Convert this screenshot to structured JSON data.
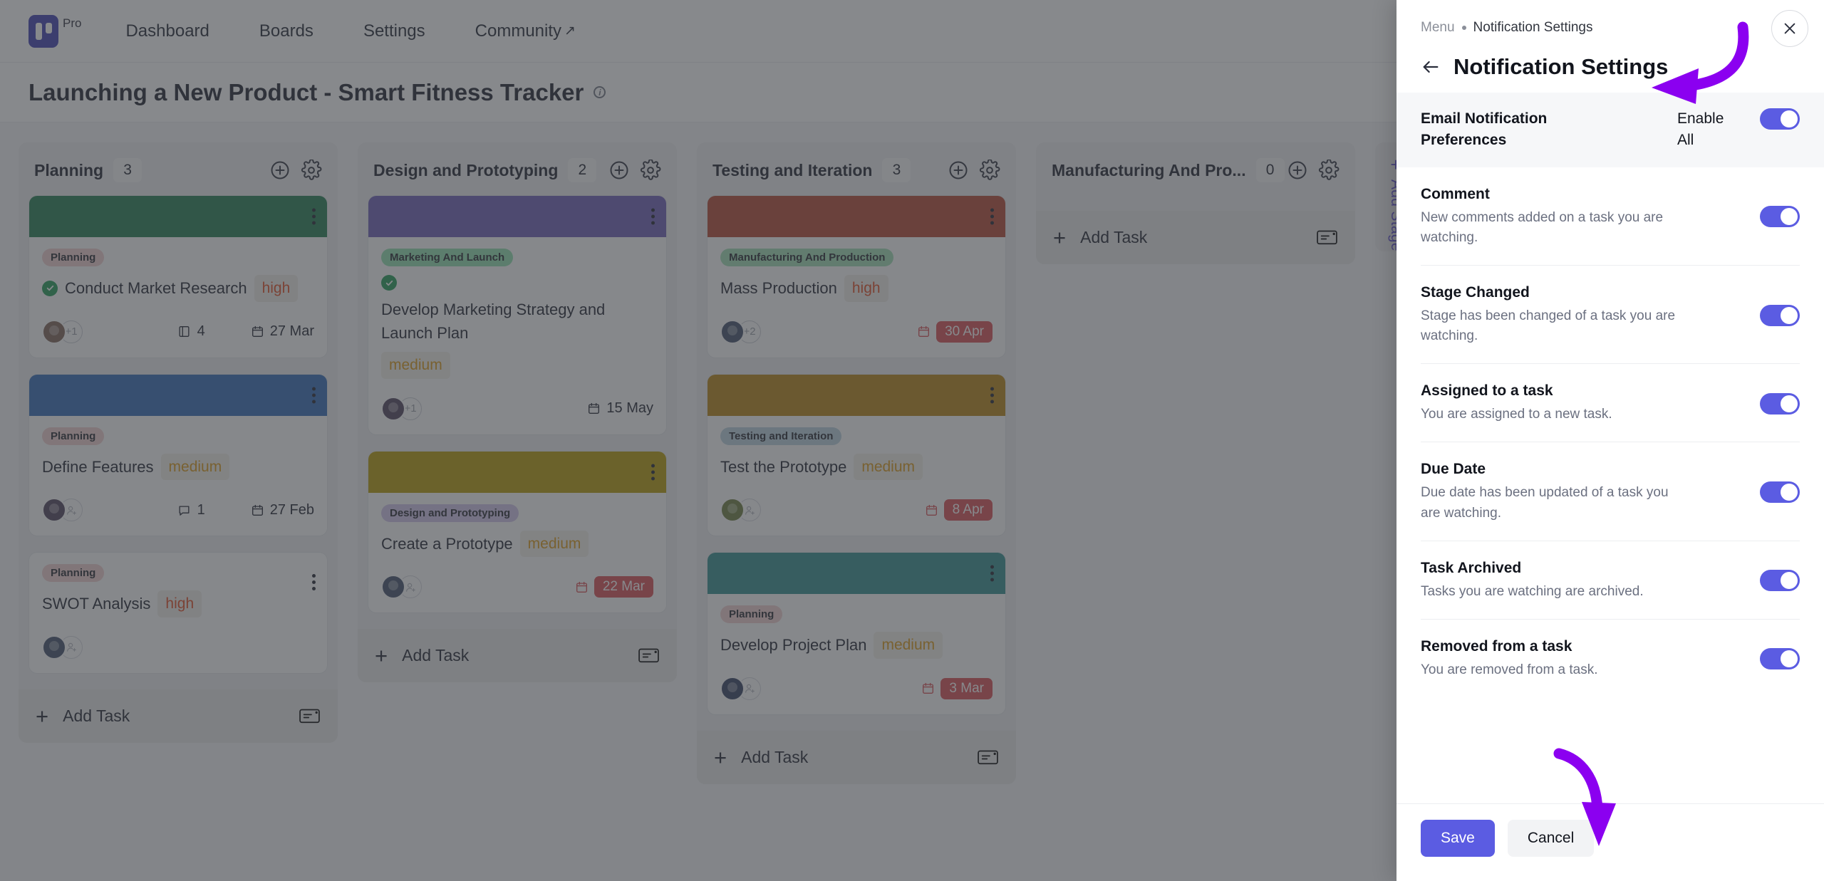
{
  "topnav": {
    "brand_tag": "Pro",
    "logo_icon": "kanban-logo-icon",
    "links": [
      {
        "label": "Dashboard",
        "external": false
      },
      {
        "label": "Boards",
        "external": false
      },
      {
        "label": "Settings",
        "external": false
      },
      {
        "label": "Community",
        "external": true,
        "external_glyph": "↗"
      }
    ]
  },
  "board": {
    "title": "Launching a New Product - Smart Fitness Tracker",
    "info_glyph": "i",
    "view_toggle_icon": "board-view-icon",
    "add_stage_label": "Add Stage",
    "add_stage_plus": "+",
    "add_task_label": "Add Task",
    "columns": [
      {
        "name": "Planning",
        "count": "3",
        "add_icon": "plus-circle-icon",
        "settings_icon": "gear-icon",
        "cards": [
          {
            "cover_color": "#1f7a4d",
            "stage_chip": "Planning",
            "chip_bg": "#f0cdcd",
            "title": "Conduct Market Research",
            "completed": true,
            "priority": "high",
            "priority_level": "high",
            "avatars": 1,
            "avatar_more": "+1",
            "avatar_add": false,
            "attachments": "4",
            "comments": null,
            "date": "27 Mar",
            "date_overdue": false
          },
          {
            "cover_color": "#2e68b5",
            "stage_chip": "Planning",
            "chip_bg": "#f0cdcd",
            "title": "Define Features",
            "completed": false,
            "priority": "medium",
            "priority_level": "medium",
            "avatars": 1,
            "avatar_more": null,
            "avatar_add": true,
            "attachments": null,
            "comments": "1",
            "date": "27 Feb",
            "date_overdue": false
          },
          {
            "cover_color": null,
            "stage_chip": "Planning",
            "chip_bg": "#f0cdcd",
            "title": "SWOT Analysis",
            "completed": false,
            "priority": "high",
            "priority_level": "high",
            "avatars": 1,
            "avatar_more": null,
            "avatar_add": true,
            "attachments": null,
            "comments": null,
            "date": null,
            "date_overdue": false
          }
        ]
      },
      {
        "name": "Design and Prototyping",
        "count": "2",
        "add_icon": "plus-circle-icon",
        "settings_icon": "gear-icon",
        "cards": [
          {
            "cover_color": "#6a5ab5",
            "stage_chip": "Marketing And Launch",
            "chip_bg": "#8fe0ad",
            "title": "Develop Marketing Strategy and Launch Plan",
            "completed": true,
            "priority": "medium",
            "priority_level": "medium",
            "avatars": 1,
            "avatar_more": "+1",
            "avatar_add": false,
            "attachments": null,
            "comments": null,
            "date": "15 May",
            "date_overdue": false
          },
          {
            "cover_color": "#b59a00",
            "stage_chip": "Design and Prototyping",
            "chip_bg": "#cfc3ea",
            "title": "Create a Prototype",
            "completed": false,
            "priority": "medium",
            "priority_level": "medium",
            "avatars": 1,
            "avatar_more": null,
            "avatar_add": true,
            "attachments": null,
            "comments": null,
            "date": "22 Mar",
            "date_overdue": true
          }
        ]
      },
      {
        "name": "Testing and Iteration",
        "count": "3",
        "add_icon": "plus-circle-icon",
        "settings_icon": "gear-icon",
        "cards": [
          {
            "cover_color": "#b2422f",
            "stage_chip": "Manufacturing And Production",
            "chip_bg": "#9ddcb4",
            "title": "Mass Production",
            "completed": false,
            "priority": "high",
            "priority_level": "high",
            "avatars": 1,
            "avatar_more": "+2",
            "avatar_add": false,
            "attachments": null,
            "comments": null,
            "date": "30 Apr",
            "date_overdue": true
          },
          {
            "cover_color": "#b5800e",
            "stage_chip": "Testing and Iteration",
            "chip_bg": "#b8cfdd",
            "title": "Test the Prototype",
            "completed": false,
            "priority": "medium",
            "priority_level": "medium",
            "avatars": 1,
            "avatar_more": null,
            "avatar_add": true,
            "attachments": null,
            "comments": null,
            "date": "8 Apr",
            "date_overdue": true
          },
          {
            "cover_color": "#2e8b8b",
            "stage_chip": "Planning",
            "chip_bg": "#f0cdcd",
            "title": "Develop Project Plan",
            "completed": false,
            "priority": "medium",
            "priority_level": "medium",
            "avatars": 1,
            "avatar_more": null,
            "avatar_add": true,
            "attachments": null,
            "comments": null,
            "date": "3 Mar",
            "date_overdue": true
          }
        ]
      },
      {
        "name": "Manufacturing And Pro...",
        "count": "0",
        "add_icon": "plus-circle-icon",
        "settings_icon": "gear-icon",
        "cards": []
      }
    ]
  },
  "panel": {
    "breadcrumb_menu": "Menu",
    "breadcrumb_current": "Notification Settings",
    "title": "Notification Settings",
    "back_icon": "arrow-left-icon",
    "close_icon": "close-icon",
    "preferences_header": {
      "title": "Email Notification Preferences",
      "action_label": "Enable All",
      "enabled": true
    },
    "preferences": [
      {
        "name": "Comment",
        "description": "New comments added on a task you are watching.",
        "enabled": true
      },
      {
        "name": "Stage Changed",
        "description": "Stage has been changed of a task you are watching.",
        "enabled": true
      },
      {
        "name": "Assigned to a task",
        "description": "You are assigned to a new task.",
        "enabled": true
      },
      {
        "name": "Due Date",
        "description": "Due date has been updated of a task you are watching.",
        "enabled": true
      },
      {
        "name": "Task Archived",
        "description": "Tasks you are watching are archived.",
        "enabled": true
      },
      {
        "name": "Removed from a task",
        "description": "You are removed from a task.",
        "enabled": true
      }
    ],
    "save_label": "Save",
    "cancel_label": "Cancel"
  },
  "colors": {
    "accent": "#5b5ce2",
    "annotation": "#8b00f0",
    "overdue": "#d84a4f",
    "high": "#e0491f",
    "medium": "#d99611"
  }
}
